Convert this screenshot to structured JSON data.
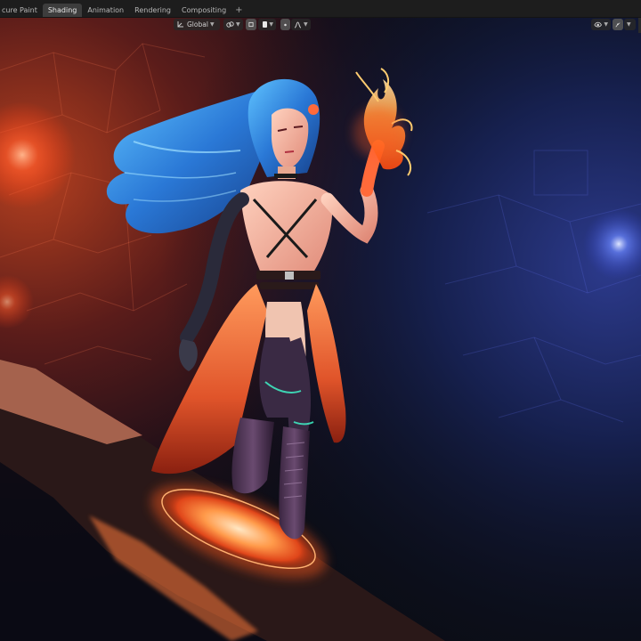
{
  "workspace_tabs": [
    {
      "label": "Texture Paint",
      "visible_text": "cure Paint",
      "active": false
    },
    {
      "label": "Shading",
      "active": true
    },
    {
      "label": "Animation",
      "active": false
    },
    {
      "label": "Rendering",
      "active": false
    },
    {
      "label": "Compositing",
      "active": false
    }
  ],
  "add_tab_label": "+",
  "viewport_header": {
    "transform_orientation": "Global"
  },
  "colors": {
    "accent_warm": "#ff6a2e",
    "accent_cool": "#4a6bff",
    "hair": "#2f7fd8",
    "ui_bg": "#1d1d1d",
    "active_tab": "#3d3d3d"
  }
}
